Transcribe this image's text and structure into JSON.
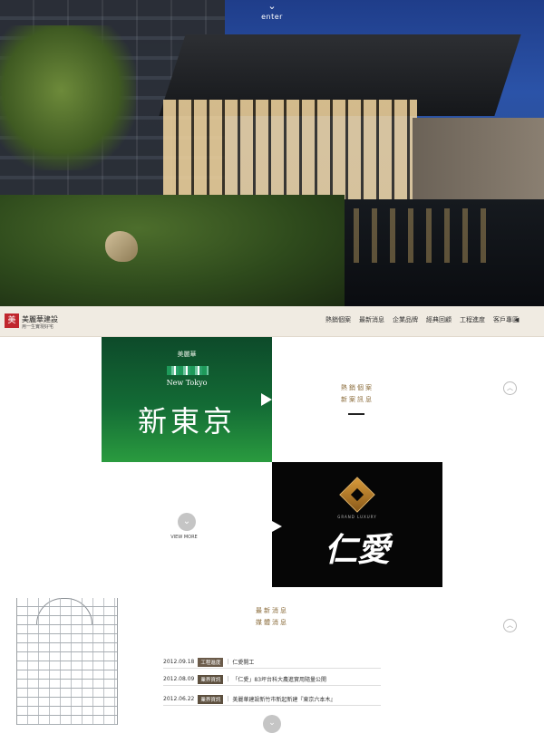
{
  "hero": {
    "enter_label": "enter",
    "enter_icon": "⌄"
  },
  "brand": {
    "mark": "美",
    "name": "美麗華建設",
    "tagline": "用一生實現好宅"
  },
  "nav": {
    "items": [
      "熱銷個案",
      "最新消息",
      "企業品牌",
      "經典回顧",
      "工程進度",
      "客戶專區"
    ],
    "sound_icon": "◀"
  },
  "projects": {
    "new_tokyo": {
      "brand": "美麗華",
      "english": "New Tokyo",
      "title": "新東京"
    },
    "grand_luxury": {
      "english": "GRAND LUXURY",
      "title": "仁愛"
    }
  },
  "featured": {
    "line1": "熱銷個案",
    "line2": "新案訊息",
    "up_icon": "︿"
  },
  "view_more": {
    "icon": "⌄",
    "label": "VIEW MORE"
  },
  "news": {
    "heading1": "最新消息",
    "heading2": "媒體消息",
    "up_icon": "︿",
    "rows": [
      {
        "date": "2012.09.18",
        "tag": "工程進度",
        "sep": "|",
        "title": "仁愛開工"
      },
      {
        "date": "2012.08.09",
        "tag": "業界資訊",
        "sep": "|",
        "title": "「仁愛」83坪台科大農進實用隨量公開"
      },
      {
        "date": "2012.06.22",
        "tag": "業界資訊",
        "sep": "|",
        "title": "美麗華建設新竹市新起新建『東京六本木』"
      }
    ],
    "bottom_icon": "⌄"
  },
  "colors": {
    "nav_bg": "#f0ebe2",
    "brand_red": "#c0262d",
    "accent_gold": "#8a6b3a",
    "tile_green": "#136b35",
    "tile_black": "#060606"
  }
}
